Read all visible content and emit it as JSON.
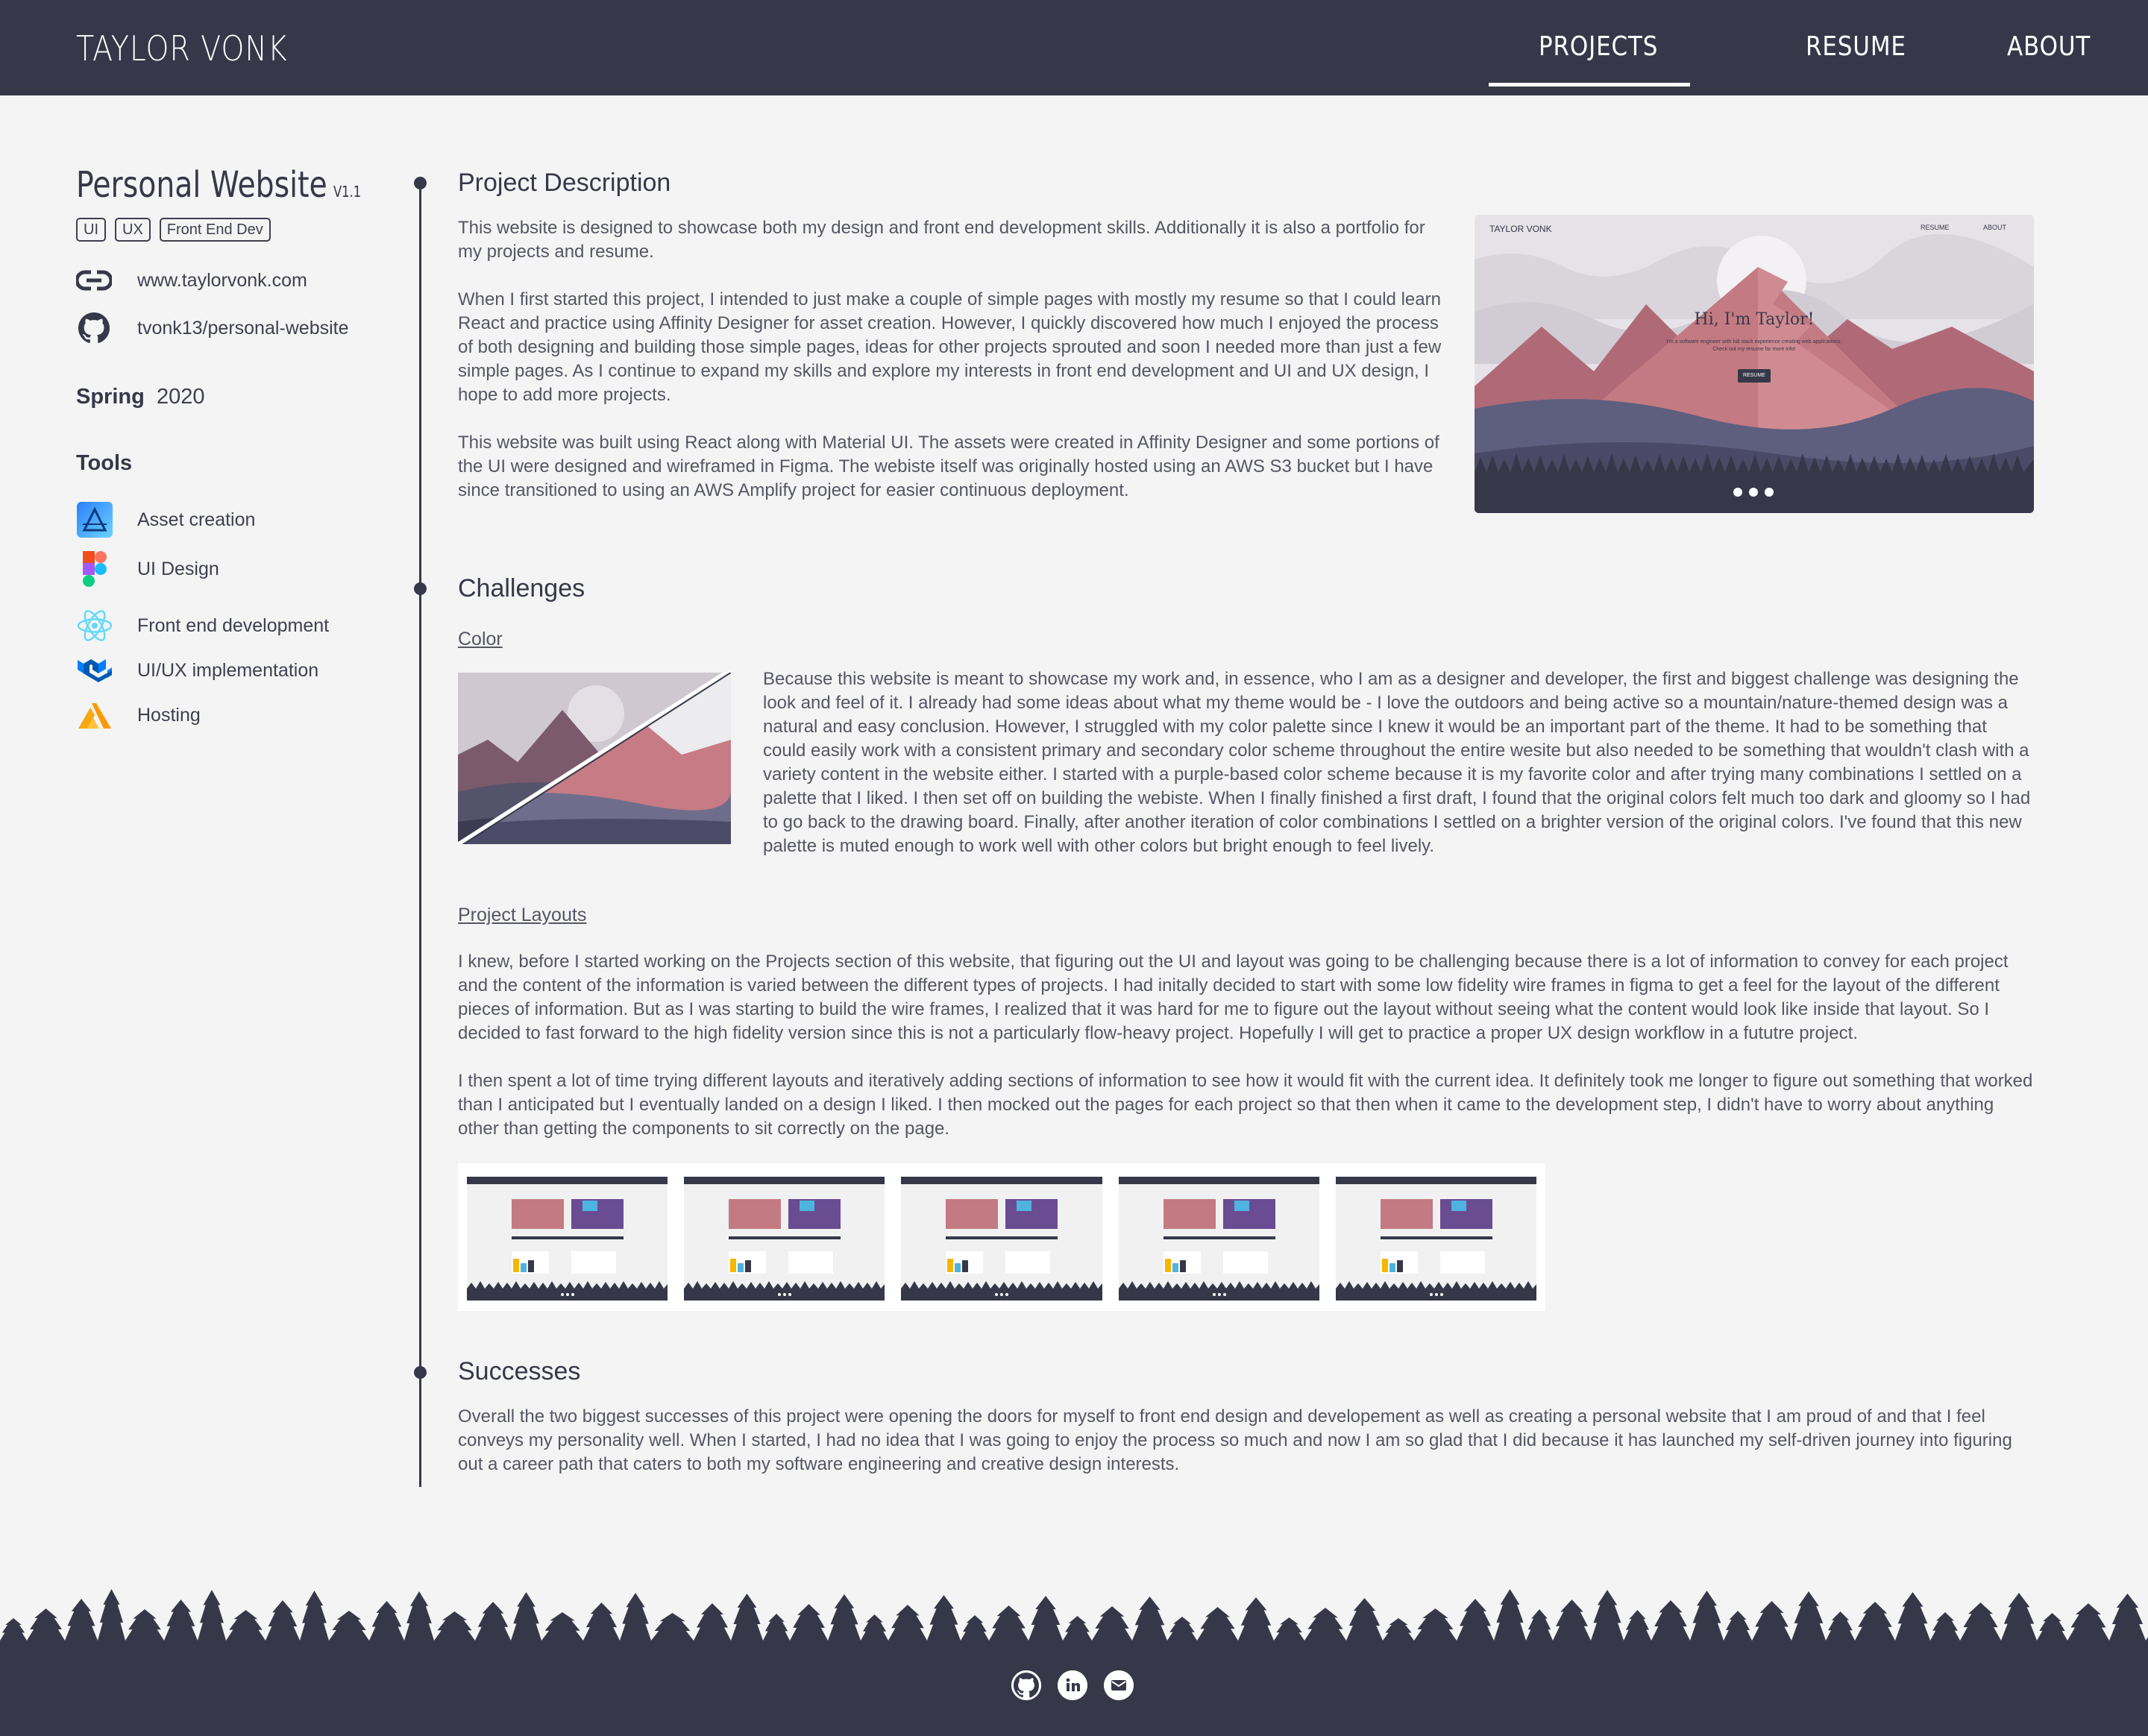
{
  "header": {
    "brand": "TAYLOR VONK",
    "nav": {
      "projects": "PROJECTS",
      "resume": "RESUME",
      "about": "ABOUT"
    },
    "active_nav": "PROJECTS"
  },
  "sidebar": {
    "title": "Personal Website",
    "version": "V1.1",
    "tags": [
      "UI",
      "UX",
      "Front End Dev"
    ],
    "website": "www.taylorvonk.com",
    "github": "tvonk13/personal-website",
    "term_season": "Spring",
    "term_year": "2020",
    "tools_heading": "Tools",
    "tools": [
      {
        "label": "Asset creation",
        "icon": "affinity-designer-icon"
      },
      {
        "label": "UI Design",
        "icon": "figma-icon"
      },
      {
        "label": "Front end development",
        "icon": "react-icon"
      },
      {
        "label": "UI/UX implementation",
        "icon": "material-ui-icon"
      },
      {
        "label": "Hosting",
        "icon": "aws-amplify-icon"
      }
    ]
  },
  "description": {
    "heading": "Project Description",
    "p1": "This website is designed to showcase both my design and front end development skills. Additionally it is also a portfolio for my projects and resume.",
    "p2": "When I first started this project, I intended to just make a couple of simple pages with mostly my resume so that I could learn React and practice using Affinity Designer for asset creation. However, I quickly discovered how much I enjoyed the process of both designing and building those simple pages, ideas for other projects sprouted and soon I needed more than just a few simple pages. As I continue to expand my skills and explore my interests in front end development and UI and UX design, I hope to add more projects.",
    "p3": "This website was built using React along with Material UI. The assets were created in Affinity Designer and some portions of the UI were designed and wireframed in Figma. The webiste itself was originally hosted using an AWS S3 bucket but I have since transitioned to using an AWS Amplify project for easier continuous deployment.",
    "preview": {
      "brand": "TAYLOR VONK",
      "nav_resume": "RESUME",
      "nav_about": "ABOUT",
      "greeting": "Hi, I'm Taylor!",
      "tagline": "I'm a software engineer with full stack experience creating web applications. Check out my resume for more info!",
      "button": "RESUME"
    }
  },
  "challenges": {
    "heading": "Challenges",
    "color_heading": "Color",
    "color_text": "Because this website is meant to showcase my work and, in essence, who I am as a designer and developer, the first and biggest challenge was designing the look and feel of it. I already had some ideas about what my theme would be - I love the outdoors and being active so a mountain/nature-themed design was a natural and easy conclusion. However, I struggled with my color palette since I knew it would be an important part of the theme. It had to be something that could easily work with a consistent primary and secondary color scheme throughout the entire wesite but also needed to be something that wouldn't clash with a variety content in the website either. I started with a purple-based color scheme because it is my favorite color and after trying many combinations I settled on a palette that I liked. I then set off on building the webiste. When I finally finished a first draft, I found that the original colors felt much too dark and gloomy so I had to go back to the drawing board. Finally, after another iteration of color combinations I settled on a brighter version of the original colors. I've found that this new palette is muted enough to work well with other colors but bright enough to feel lively.",
    "layouts_heading": "Project Layouts",
    "layouts_p1": "I knew, before I started working on the Projects section of this website, that figuring out the UI and layout was going to be challenging because there is a lot of information to convey for each project and the content of the information is varied between the different types of projects. I had initally decided to start with some low fidelity wire frames in figma to get a feel for the layout of the different pieces of information. But as I was starting to build the wire frames, I realized that it was hard for me to figure out the layout without seeing what the content would look like inside that layout. So I decided to fast forward to the high fidelity version since this is not a particularly flow-heavy project. Hopefully I will get to practice a proper UX design workflow in a fututre project.",
    "layouts_p2": "I then spent a lot of time trying different layouts and iteratively adding sections of information to see how it would fit with the current idea. It definitely took me longer to figure out something that worked than I anticipated but I eventually landed on a design I liked. I then mocked out the pages for each project so that then when it came to the development step, I didn't have to worry about anything other than getting the components to sit correctly on the page."
  },
  "successes": {
    "heading": "Successes",
    "text": "Overall the two biggest successes of this project were opening the doors for myself to front end design and developement as well as creating a personal website that I am proud of and that I feel conveys my personality well. When I started, I had no idea that I was going to enjoy the process so much and now I am so glad that I did because it has launched my self-driven journey into figuring out a career path that caters to both my software engineering and creative design interests."
  },
  "footer": {
    "icons": [
      "github-icon",
      "linkedin-icon",
      "email-icon"
    ]
  },
  "colors": {
    "primary": "#363849",
    "background": "#f4f4f4",
    "mountain_pink": "#c47a82",
    "mountain_purple": "#5a5a78"
  }
}
